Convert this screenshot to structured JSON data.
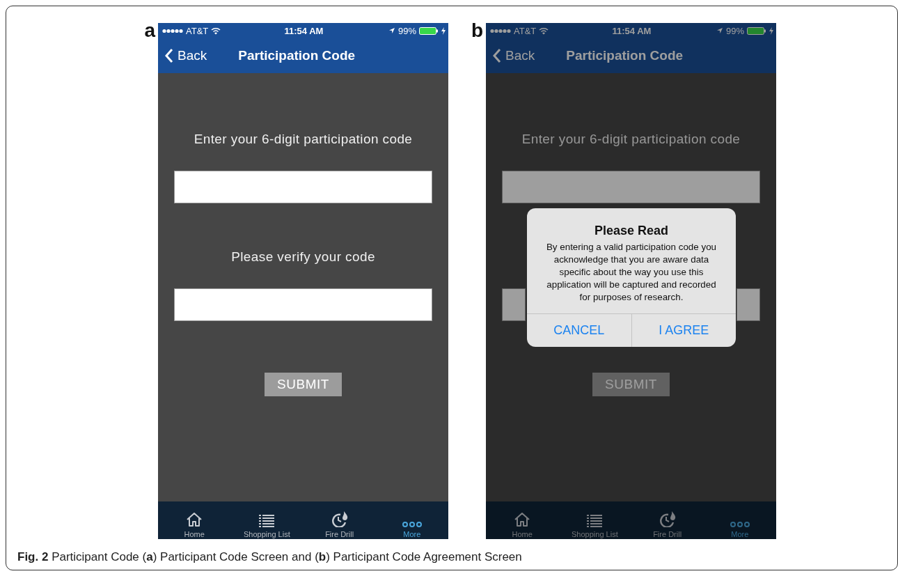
{
  "panels": [
    {
      "label": "a",
      "dimmed": false,
      "status_bar": {
        "carrier": "AT&T",
        "time": "11:54 AM",
        "battery": "99%"
      },
      "nav": {
        "back": "Back",
        "title": "Participation Code"
      },
      "fields": [
        {
          "kind": "labeled",
          "label": "Enter your 6-digit participation code"
        },
        {
          "kind": "labeled",
          "label": "Please verify your code"
        }
      ],
      "submit": "SUBMIT",
      "tabs": [
        {
          "label": "Home",
          "selected": false
        },
        {
          "label": "Shopping List",
          "selected": false
        },
        {
          "label": "Fire Drill",
          "selected": false
        },
        {
          "label": "More",
          "selected": true
        }
      ]
    },
    {
      "label": "b",
      "dimmed": true,
      "status_bar": {
        "carrier": "AT&T",
        "time": "11:54 AM",
        "battery": "99%"
      },
      "nav": {
        "back": "Back",
        "title": "Participation Code"
      },
      "fields": [
        {
          "kind": "labeled",
          "label": "Enter your 6-digit participation code"
        },
        {
          "kind": "covered"
        }
      ],
      "submit": "SUBMIT",
      "tabs": [
        {
          "label": "Home",
          "selected": false
        },
        {
          "label": "Shopping List",
          "selected": false
        },
        {
          "label": "Fire Drill",
          "selected": false
        },
        {
          "label": "More",
          "selected": true
        }
      ],
      "alert": {
        "title": "Please Read",
        "message": "By entering a valid participation code you acknowledge that you are aware data specific about the way you use this application will be captured and recorded for purposes of research.",
        "buttons": [
          "CANCEL",
          "I AGREE"
        ]
      }
    }
  ],
  "caption": "**Fig. 2** Participant Code (**a**) Participant Code Screen and (**b**) Participant Code Agreement Screen"
}
